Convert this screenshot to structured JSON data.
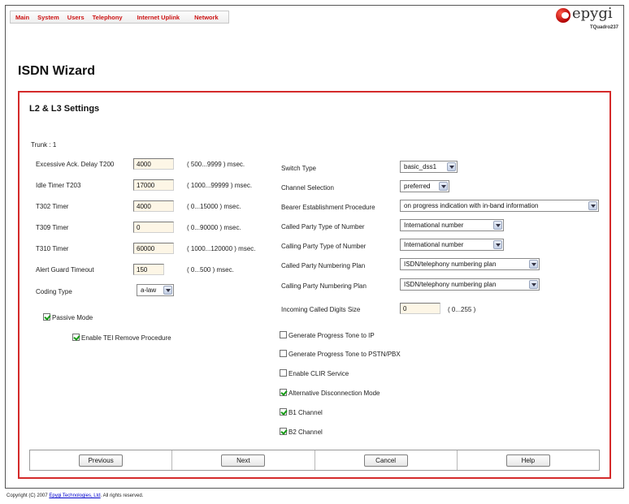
{
  "nav": [
    "Main",
    "System",
    "Users",
    "Telephony",
    "Internet Uplink",
    "Network"
  ],
  "logo": {
    "word": "epygi",
    "model": "TQuadro237"
  },
  "page_title": "ISDN Wizard",
  "panel_title": "L2 & L3 Settings",
  "trunk": "Trunk : 1",
  "left_fields": [
    {
      "label": "Excessive Ack. Delay T200",
      "value": "4000",
      "range": "( 500...9999 ) msec."
    },
    {
      "label": "Idle Timer T203",
      "value": "17000",
      "range": "( 1000...99999 ) msec."
    },
    {
      "label": "T302 Timer",
      "value": "4000",
      "range": "( 0...15000 ) msec."
    },
    {
      "label": "T309 Timer",
      "value": "0",
      "range": "( 0...90000 ) msec."
    },
    {
      "label": "T310 Timer",
      "value": "60000",
      "range": "( 1000...120000 ) msec."
    },
    {
      "label": "Alert Guard Timeout",
      "value": "150",
      "range": "( 0...500 ) msec."
    }
  ],
  "coding_type": {
    "label": "Coding Type",
    "value": "a-law"
  },
  "passive_mode": {
    "label": "Passive Mode",
    "checked": true
  },
  "tei_remove": {
    "label": "Enable TEI Remove Procedure",
    "checked": true
  },
  "right_selects": [
    {
      "label": "Switch Type",
      "value": "basic_dss1"
    },
    {
      "label": "Channel Selection",
      "value": "preferred"
    },
    {
      "label": "Bearer Establishment Procedure",
      "value": "on progress indication with in-band information"
    },
    {
      "label": "Called Party Type of Number",
      "value": "International number"
    },
    {
      "label": "Calling Party Type of Number",
      "value": "International number"
    },
    {
      "label": "Called Party Numbering Plan",
      "value": "ISDN/telephony numbering plan"
    },
    {
      "label": "Calling Party Numbering Plan",
      "value": "ISDN/telephony numbering plan"
    }
  ],
  "incoming_digits": {
    "label": "Incoming Called Digits Size",
    "value": "0",
    "range": "( 0...255 )"
  },
  "right_checks": [
    {
      "label": "Generate Progress Tone to IP",
      "checked": false
    },
    {
      "label": "Generate Progress Tone to PSTN/PBX",
      "checked": false
    },
    {
      "label": "Enable CLIR Service",
      "checked": false
    },
    {
      "label": "Alternative Disconnection Mode",
      "checked": true
    },
    {
      "label": "B1 Channel",
      "checked": true
    },
    {
      "label": "B2 Channel",
      "checked": true
    }
  ],
  "buttons": {
    "previous": "Previous",
    "next": "Next",
    "cancel": "Cancel",
    "help": "Help"
  },
  "footer": {
    "prefix": "Copyright (C) 2007 ",
    "link": "Epygi Technologies, Ltd",
    "suffix": ". All rights reserved."
  },
  "colors": {
    "accent": "#d42a2a",
    "nav_text": "#cc1111",
    "input_bg": "#fdf6e6",
    "check": "#159a15"
  }
}
